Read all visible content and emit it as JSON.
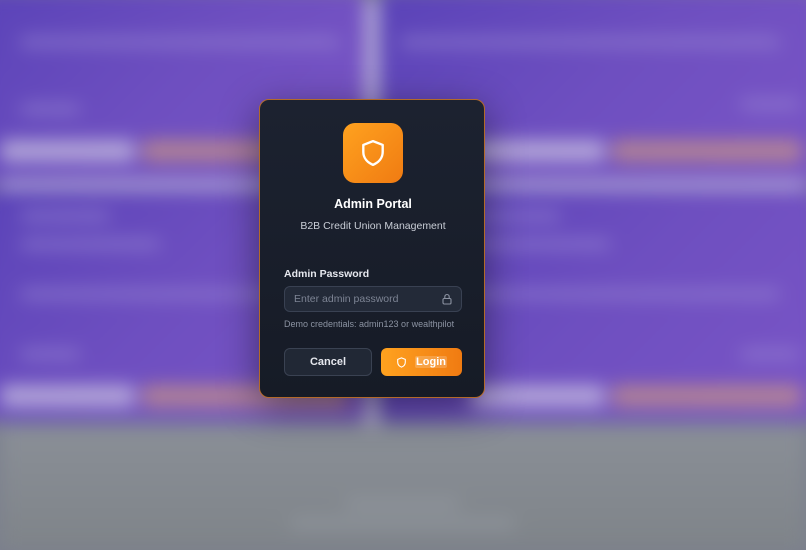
{
  "modal": {
    "logo_icon": "shield-icon",
    "title": "Admin Portal",
    "subtitle": "B2B Credit Union Management",
    "password_label": "Admin Password",
    "password_placeholder": "Enter admin password",
    "password_value": "",
    "lock_icon": "lock-icon",
    "hint": "Demo credentials: admin123 or wealthpilot",
    "cancel_label": "Cancel",
    "login_label": "Login",
    "login_icon": "shield-icon"
  },
  "colors": {
    "accent": "#f7901a",
    "modal_bg": "#1a1f2b",
    "modal_border": "#b36a2a",
    "background_purple": "#6a4fb0"
  }
}
